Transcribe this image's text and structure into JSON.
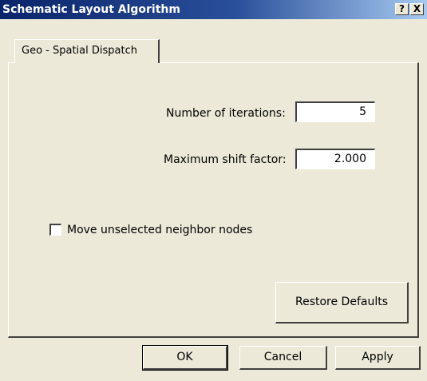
{
  "window": {
    "title": "Schematic Layout Algorithm",
    "help_glyph": "?",
    "close_glyph": "X"
  },
  "tabs": [
    {
      "label": "Geo - Spatial Dispatch",
      "selected": true
    }
  ],
  "form": {
    "iterations_label": "Number of iterations:",
    "iterations_value": "5",
    "shift_label": "Maximum shift factor:",
    "shift_value": "2.000",
    "move_neighbors_label": "Move unselected neighbor nodes",
    "move_neighbors_checked": false,
    "restore_defaults_label": "Restore Defaults"
  },
  "footer": {
    "ok_label": "OK",
    "cancel_label": "Cancel",
    "apply_label": "Apply"
  }
}
